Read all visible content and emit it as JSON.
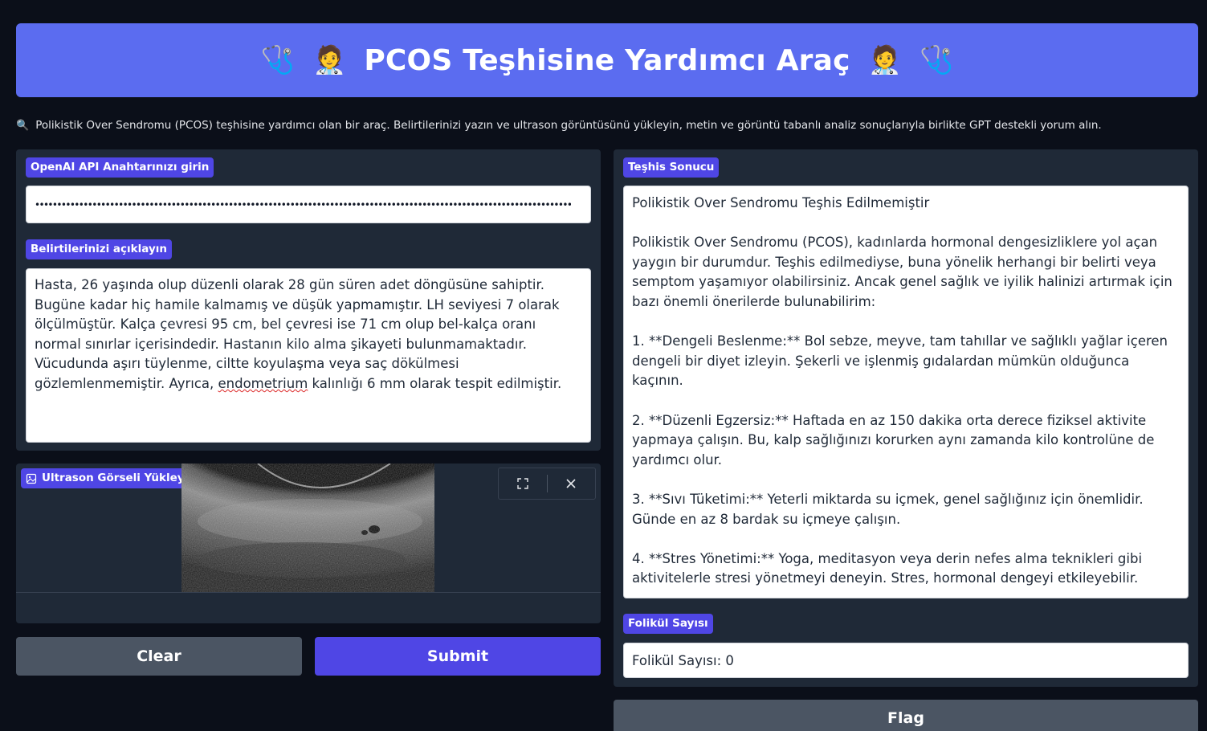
{
  "header": {
    "title": "PCOS Teşhisine Yardımcı Araç",
    "left_icons": [
      "🩺",
      "🧑‍⚕️"
    ],
    "right_icons": [
      "🧑‍⚕️",
      "🩺"
    ],
    "accent": "#5b6cf0"
  },
  "description": {
    "icon": "🔍",
    "text": "Polikistik Over Sendromu (PCOS) teşhisine yardımcı olan bir araç. Belirtilerinizi yazın ve ultrason görüntüsünü yükleyin, metin ve görüntü tabanlı analiz sonuçlarıyla birlikte GPT destekli yorum alın."
  },
  "api_key": {
    "label": "OpenAI API Anahtarınızı girin",
    "value": "••••••••••••••••••••••••••••••••••••••••••••••••••••••••••••••••••••••••••••••••••••••••••••••••••••••••••••••••••••••••••"
  },
  "symptoms": {
    "label": "Belirtilerinizi açıklayın",
    "text_before": "Hasta, 26 yaşında olup düzenli olarak 28 gün süren adet döngüsüne sahiptir. Bugüne kadar hiç hamile kalmamış ve düşük yapmamıştır. LH seviyesi 7 olarak ölçülmüştür. Kalça çevresi 95 cm, bel çevresi ise 71 cm olup bel-kalça oranı normal sınırlar içerisindedir. Hastanın kilo alma şikayeti bulunmamaktadır. Vücudunda aşırı tüylenme, ciltte koyulaşma veya saç dökülmesi gözlemlenmemiştir. Ayrıca, ",
    "text_flagged": "endometrium",
    "text_after": " kalınlığı 6 mm olarak tespit edilmiştir."
  },
  "ultrasound": {
    "label": "Ultrason Görseli Yükleyin",
    "icon": "image-icon"
  },
  "buttons": {
    "clear": "Clear",
    "submit": "Submit",
    "flag": "Flag"
  },
  "diagnosis": {
    "label": "Teşhis Sonucu",
    "text": "Polikistik Over Sendromu Teşhis Edilmemiştir\n\nPolikistik Over Sendromu (PCOS), kadınlarda hormonal dengesizliklere yol açan yaygın bir durumdur. Teşhis edilmediyse, buna yönelik herhangi bir belirti veya semptom yaşamıyor olabilirsiniz. Ancak genel sağlık ve iyilik halinizi artırmak için bazı önemli önerilerde bulunabilirim:\n\n1. **Dengeli Beslenme:** Bol sebze, meyve, tam tahıllar ve sağlıklı yağlar içeren dengeli bir diyet izleyin. Şekerli ve işlenmiş gıdalardan mümkün olduğunca kaçının.\n\n2. **Düzenli Egzersiz:** Haftada en az 150 dakika orta derece fiziksel aktivite yapmaya çalışın. Bu, kalp sağlığınızı korurken aynı zamanda kilo kontrolüne de yardımcı olur.\n\n3. **Sıvı Tüketimi:** Yeterli miktarda su içmek, genel sağlığınız için önemlidir. Günde en az 8 bardak su içmeye çalışın.\n\n4. **Stres Yönetimi:** Yoga, meditasyon veya derin nefes alma teknikleri gibi aktivitelerle stresi yönetmeyi deneyin. Stres, hormonal dengeyi etkileyebilir."
  },
  "follicle": {
    "label": "Folikül Sayısı",
    "text": "Folikül Sayısı: 0"
  }
}
